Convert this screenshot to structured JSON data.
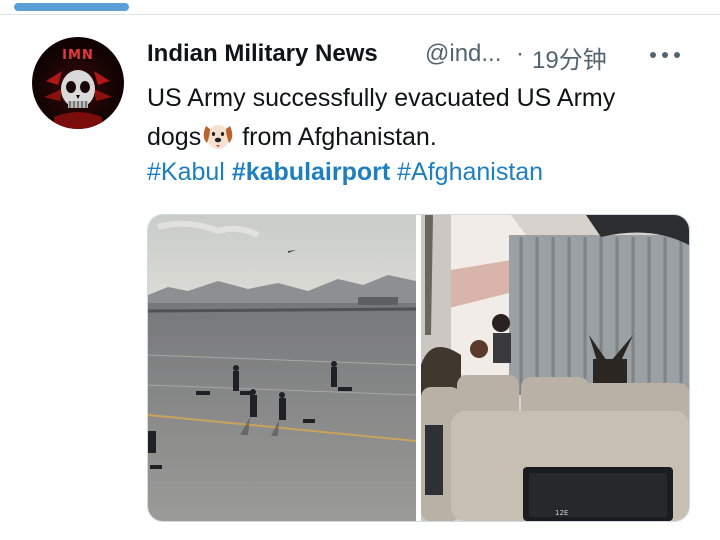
{
  "tweet": {
    "author_name": "Indian Military News",
    "handle": "@ind...",
    "separator": "·",
    "timestamp": "19分钟",
    "avatar_logo_text": "IMN",
    "text_line1": "US Army successfully evacuated US Army",
    "text_line2_before": "dogs",
    "text_line2_after": "from Afghanistan.",
    "hashtags": [
      "#Kabul",
      "#kabulairport",
      "#Afghanistan"
    ],
    "photos": [
      {
        "subject": "soldiers with dogs on airport tarmac"
      },
      {
        "subject": "dog aboard aircraft cabin",
        "seat_label": "12E"
      }
    ]
  },
  "icons": {
    "more": "more-horizontal-icon",
    "emoji": "dog-face-emoji-icon"
  },
  "colors": {
    "hashtag": "#1d7fbf",
    "text": "#0f1419",
    "secondary": "#536471",
    "topbar_accent": "#5b9fd9"
  }
}
